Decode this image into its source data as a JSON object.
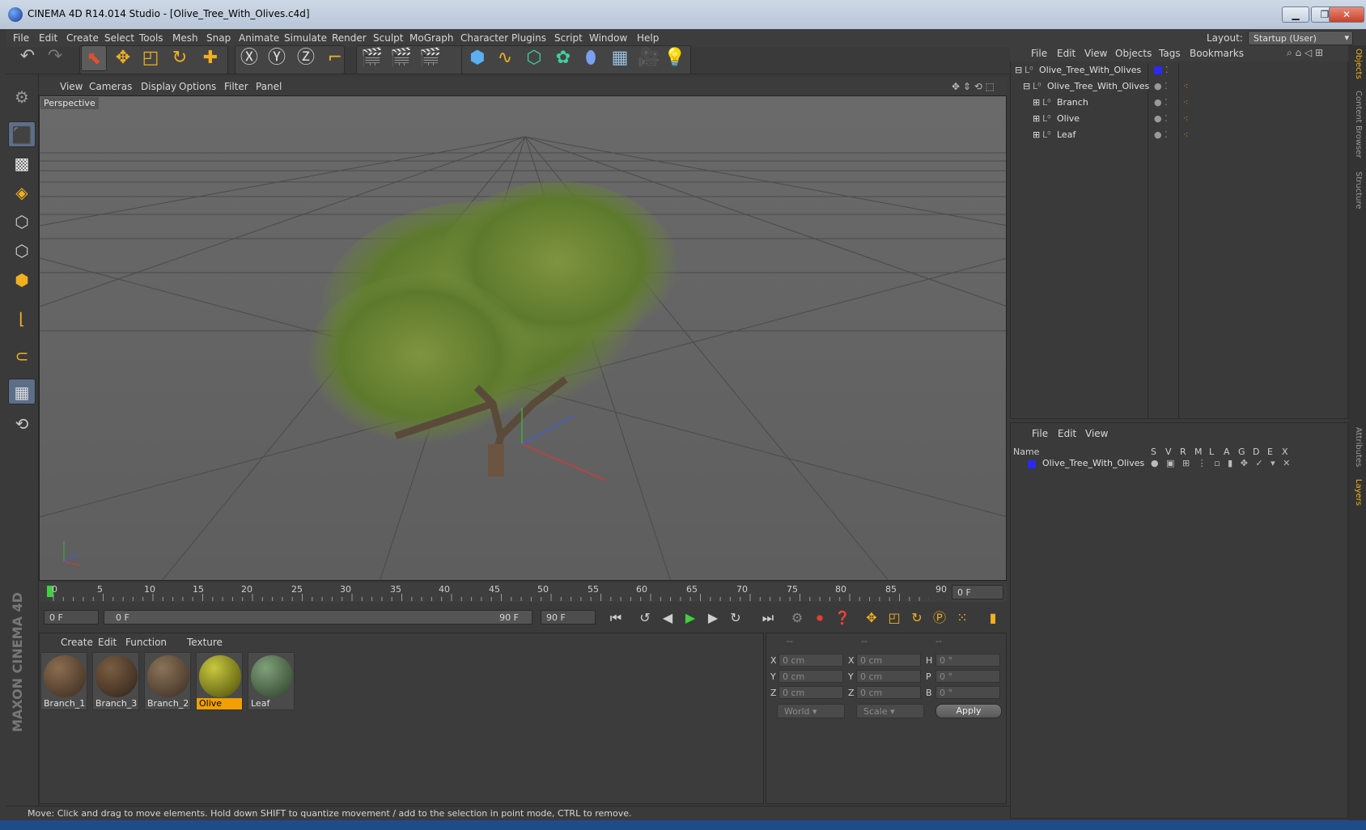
{
  "window": {
    "title": "CINEMA 4D R14.014 Studio - [Olive_Tree_With_Olives.c4d]"
  },
  "menu": [
    "File",
    "Edit",
    "Create",
    "Select",
    "Tools",
    "Mesh",
    "Snap",
    "Animate",
    "Simulate",
    "Render",
    "Sculpt",
    "MoGraph",
    "Character",
    "Plugins",
    "Script",
    "Window",
    "Help"
  ],
  "layout": {
    "label": "Layout:",
    "value": "Startup (User)"
  },
  "viewport": {
    "menu": [
      "View",
      "Cameras",
      "Display",
      "Options",
      "Filter",
      "Panel"
    ],
    "label": "Perspective"
  },
  "timeline": {
    "ticks": [
      "0",
      "5",
      "10",
      "15",
      "20",
      "25",
      "30",
      "35",
      "40",
      "45",
      "50",
      "55",
      "60",
      "65",
      "70",
      "75",
      "80",
      "85",
      "90"
    ],
    "current": "0 F",
    "start": "0 F",
    "range_start": "0 F",
    "range_end": "90 F",
    "end": "90 F"
  },
  "materials": {
    "menu": [
      "Create",
      "Edit",
      "Function",
      "Texture"
    ],
    "items": [
      "Branch_1",
      "Branch_3",
      "Branch_2",
      "Olive",
      "Leaf"
    ]
  },
  "coords": {
    "headers": [
      "--",
      "--",
      "--"
    ],
    "pos_labels": [
      "X",
      "Y",
      "Z"
    ],
    "size_labels": [
      "X",
      "Y",
      "Z"
    ],
    "rot_labels": [
      "H",
      "P",
      "B"
    ],
    "pos_values": [
      "0 cm",
      "0 cm",
      "0 cm"
    ],
    "size_values": [
      "0 cm",
      "0 cm",
      "0 cm"
    ],
    "rot_values": [
      "0 °",
      "0 °",
      "0 °"
    ],
    "world": "World",
    "scale": "Scale",
    "apply": "Apply"
  },
  "objects": {
    "menu": [
      "File",
      "Edit",
      "View",
      "Objects",
      "Tags",
      "Bookmarks"
    ],
    "items": [
      "Olive_Tree_With_Olives",
      "Olive_Tree_With_Olives",
      "Branch",
      "Olive",
      "Leaf"
    ]
  },
  "layers": {
    "menu": [
      "File",
      "Edit",
      "View"
    ],
    "headers": [
      "Name",
      "S",
      "V",
      "R",
      "M",
      "L",
      "A",
      "G",
      "D",
      "E",
      "X"
    ],
    "items": [
      "Olive_Tree_With_Olives"
    ]
  },
  "sidetabs": [
    "Objects",
    "Content Browser",
    "Structure",
    "Attributes",
    "Layers"
  ],
  "status": "Move: Click and drag to move elements. Hold down SHIFT to quantize movement / add to the selection in point mode, CTRL to remove.",
  "brand": "MAXON CINEMA 4D"
}
